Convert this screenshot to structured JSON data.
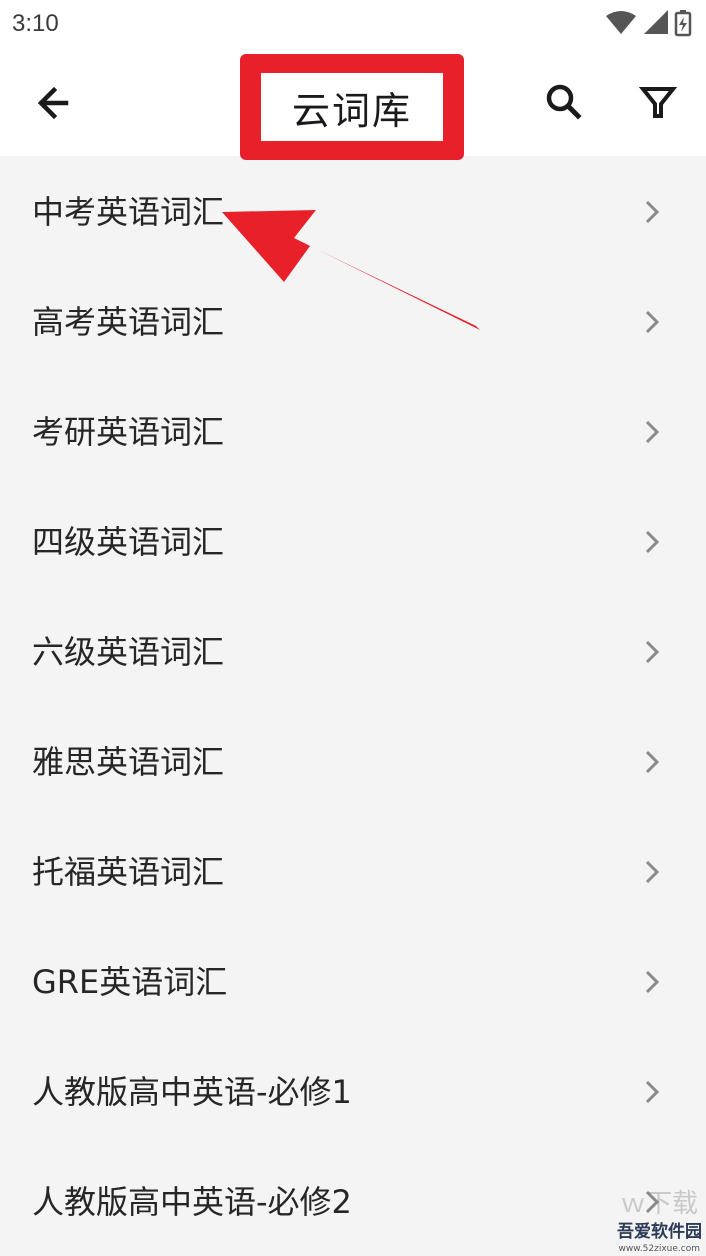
{
  "status_bar": {
    "time": "3:10",
    "icons": [
      "wifi-icon",
      "cellular-signal-icon",
      "battery-charging-icon"
    ]
  },
  "app_bar": {
    "title": "云词库",
    "back_icon": "arrow-left-icon",
    "search_icon": "search-icon",
    "filter_icon": "filter-icon"
  },
  "annotation": {
    "highlight_color": "#e8202a"
  },
  "list": {
    "items": [
      {
        "label": "中考英语词汇"
      },
      {
        "label": "高考英语词汇"
      },
      {
        "label": "考研英语词汇"
      },
      {
        "label": "四级英语词汇"
      },
      {
        "label": "六级英语词汇"
      },
      {
        "label": "雅思英语词汇"
      },
      {
        "label": "托福英语词汇"
      },
      {
        "label": "GRE英语词汇"
      },
      {
        "label": "人教版高中英语-必修1"
      },
      {
        "label": "人教版高中英语-必修2"
      }
    ],
    "chevron_icon": "chevron-right-icon"
  },
  "watermark": {
    "faint_text": "ｗ下载",
    "text": "吾爱软件园",
    "url": "www.52zixue.com"
  },
  "colors": {
    "background": "#f5f4f5",
    "app_bar": "#ffffff",
    "annotation_red": "#e8202a",
    "text": "#262626",
    "chevron": "#8a8a8a"
  }
}
